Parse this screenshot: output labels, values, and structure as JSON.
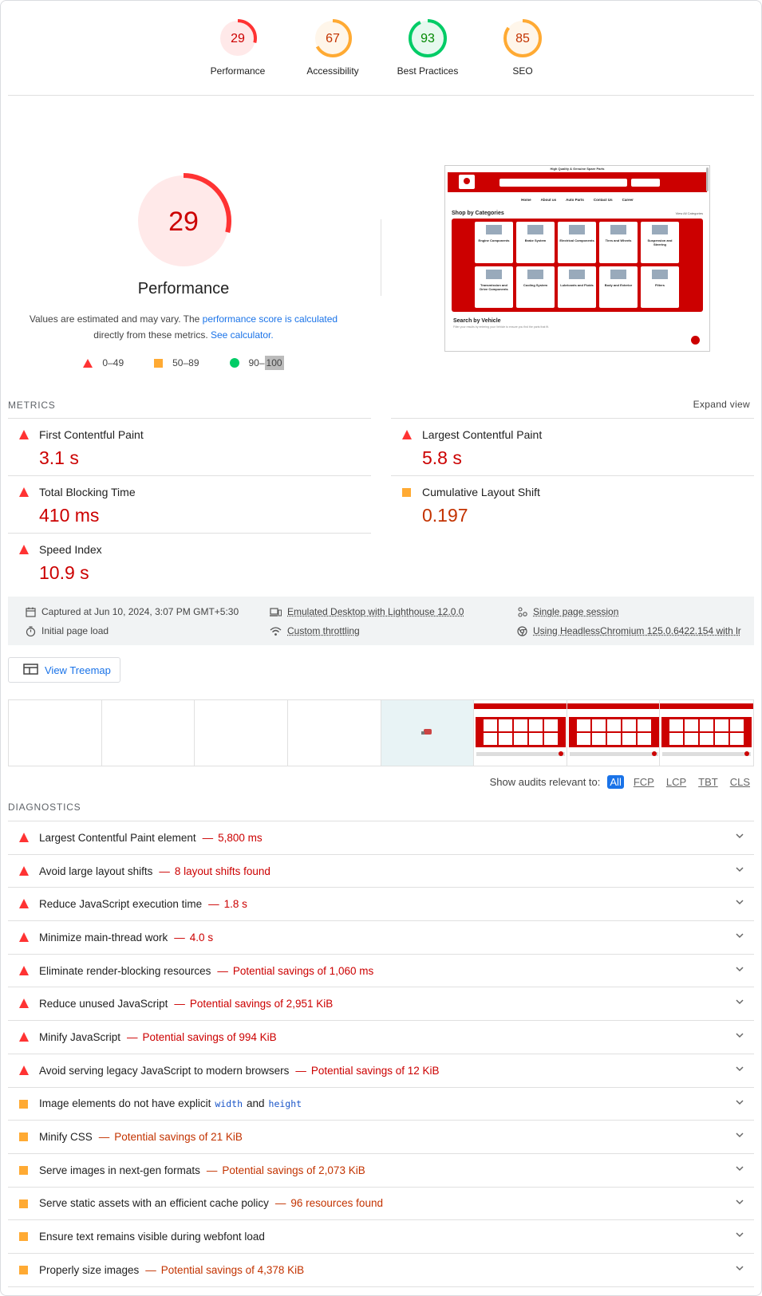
{
  "scores": [
    {
      "value": "29",
      "label": "Performance",
      "fraction": 0.29,
      "color": "#ff3333",
      "fill": "#ffe9e9",
      "text": "#cc0000"
    },
    {
      "value": "67",
      "label": "Accessibility",
      "fraction": 0.67,
      "color": "#ffaa33",
      "fill": "#fff6ea",
      "text": "#c33300"
    },
    {
      "value": "93",
      "label": "Best Practices",
      "fraction": 0.93,
      "color": "#00cc66",
      "fill": "#e6f9ef",
      "text": "#008800"
    },
    {
      "value": "85",
      "label": "SEO",
      "fraction": 0.85,
      "color": "#ffaa33",
      "fill": "#fff6ea",
      "text": "#c33300"
    }
  ],
  "performance": {
    "score": "29",
    "fraction": 0.29,
    "title": "Performance",
    "desc_1": "Values are estimated and may vary. The ",
    "link_1": "performance score is calculated",
    "desc_2": "directly from these metrics. ",
    "link_2": "See calculator.",
    "legend": {
      "fail": "0–49",
      "average": "50–89",
      "pass_a": "90–",
      "pass_b": "100"
    }
  },
  "thumbnail": {
    "top_text": "High Quality & Genuine Spare Parts",
    "nav": [
      "Home",
      "About us",
      "Auto Parts",
      "Contact Us",
      "Career"
    ],
    "shop_title": "Shop by Categories",
    "view_all": "View All Categories",
    "cards": [
      "Engine Components",
      "Brake System",
      "Electrical Components",
      "Tires and Wheels",
      "Suspension and Steering",
      "Transmission and Drive Components",
      "Cooling System",
      "Lubricants and Fluids",
      "Body and Exterior",
      "Filters"
    ],
    "search_title": "Search by Vehicle",
    "search_sub": "Filter your results by entering your Vehicle to ensure you find the parts that fit."
  },
  "metrics": {
    "title": "METRICS",
    "expand": "Expand view",
    "items": [
      {
        "name": "First Contentful Paint",
        "value": "3.1 s"
      },
      {
        "name": "Largest Contentful Paint",
        "value": "5.8 s"
      },
      {
        "name": "Total Blocking Time",
        "value": "410 ms"
      },
      {
        "name": "Cumulative Layout Shift",
        "value": "0.197"
      },
      {
        "name": "Speed Index",
        "value": "10.9 s"
      }
    ]
  },
  "info": {
    "captured": "Captured at Jun 10, 2024, 3:07 PM GMT+5:30",
    "load": "Initial page load",
    "device": "Emulated Desktop with Lighthouse 12.0.0",
    "throttling": "Custom throttling",
    "session": "Single page session",
    "browser": "Using HeadlessChromium 125.0.6422.154 with lr"
  },
  "treemap": "View Treemap",
  "filter": {
    "label": "Show audits relevant to:",
    "chips": [
      "All",
      "FCP",
      "LCP",
      "TBT",
      "CLS"
    ]
  },
  "diagnostics": {
    "title": "DIAGNOSTICS",
    "items": [
      {
        "title": "Largest Contentful Paint element",
        "display": "5,800 ms",
        "level": "fail"
      },
      {
        "title": "Avoid large layout shifts",
        "display": "8 layout shifts found",
        "level": "fail"
      },
      {
        "title": "Reduce JavaScript execution time",
        "display": "1.8 s",
        "level": "fail"
      },
      {
        "title": "Minimize main-thread work",
        "display": "4.0 s",
        "level": "fail"
      },
      {
        "title": "Eliminate render-blocking resources",
        "display": "Potential savings of 1,060 ms",
        "level": "fail"
      },
      {
        "title": "Reduce unused JavaScript",
        "display": "Potential savings of 2,951 KiB",
        "level": "fail"
      },
      {
        "title": "Minify JavaScript",
        "display": "Potential savings of 994 KiB",
        "level": "fail"
      },
      {
        "title": "Avoid serving legacy JavaScript to modern browsers",
        "display": "Potential savings of 12 KiB",
        "level": "fail"
      },
      {
        "title_a": "Image elements do not have explicit",
        "code_1": "width",
        "title_b": "and",
        "code_2": "height",
        "level": "average"
      },
      {
        "title": "Minify CSS",
        "display": "Potential savings of 21 KiB",
        "level": "average"
      },
      {
        "title": "Serve images in next-gen formats",
        "display": "Potential savings of 2,073 KiB",
        "level": "average"
      },
      {
        "title": "Serve static assets with an efficient cache policy",
        "display": "96 resources found",
        "level": "average"
      },
      {
        "title": "Ensure text remains visible during webfont load",
        "level": "average"
      },
      {
        "title": "Properly size images",
        "display": "Potential savings of 4,378 KiB",
        "level": "average"
      }
    ]
  },
  "dash": "—"
}
